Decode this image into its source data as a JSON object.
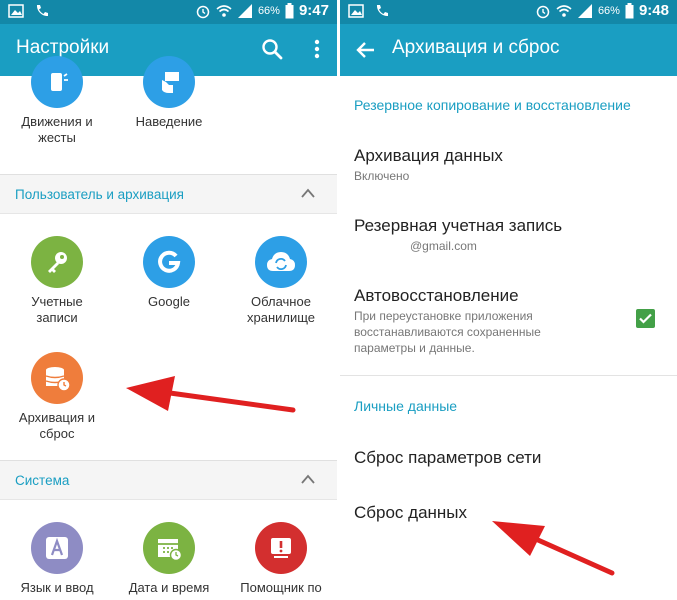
{
  "left": {
    "status": {
      "battery": "66%",
      "time": "9:47"
    },
    "title": "Настройки",
    "items_top": [
      {
        "label": "Движения и жесты"
      },
      {
        "label": "Наведение"
      }
    ],
    "section_user": "Пользователь и архивация",
    "items_user": [
      {
        "label": "Учетные записи"
      },
      {
        "label": "Google"
      },
      {
        "label": "Облачное хранилище"
      },
      {
        "label": "Архивация и сброс"
      }
    ],
    "section_system": "Система",
    "items_system": [
      {
        "label": "Язык и ввод"
      },
      {
        "label": "Дата и время"
      },
      {
        "label": "Помощник по"
      }
    ]
  },
  "right": {
    "status": {
      "battery": "66%",
      "time": "9:48"
    },
    "title": "Архивация и сброс",
    "category_backup": "Резервное копирование и восстановление",
    "backup_data": {
      "title": "Архивация данных",
      "subtitle": "Включено"
    },
    "backup_account": {
      "title": "Резервная учетная запись",
      "subtitle": "@gmail.com"
    },
    "auto_restore": {
      "title": "Автовосстановление",
      "subtitle": "При переустановке приложения восстанавливаются сохраненные параметры и данные.",
      "checked": true
    },
    "category_personal": "Личные данные",
    "network_reset": "Сброс параметров сети",
    "factory_reset": "Сброс данных"
  },
  "colors": {
    "statusbar": "#1388a8",
    "appbar": "#1a9ec2",
    "accent": "#1a9ec2",
    "arrow": "#e02020",
    "checkbox": "#43a047"
  }
}
